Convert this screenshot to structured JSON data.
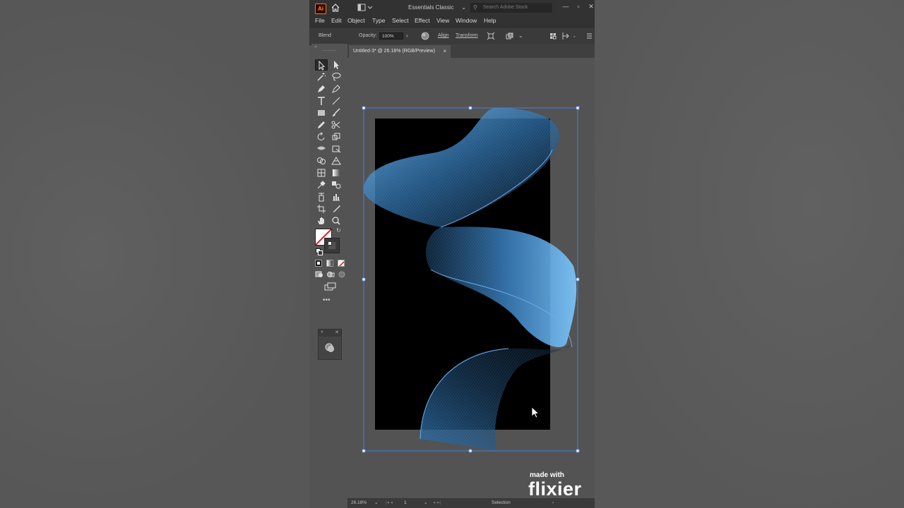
{
  "app": {
    "logo": "Ai",
    "workspace": "Essentials Classic",
    "search_placeholder": "Search Adobe Stock",
    "menus": [
      "File",
      "Edit",
      "Object",
      "Type",
      "Select",
      "Effect",
      "View",
      "Window",
      "Help"
    ]
  },
  "controlbar": {
    "selection_type": "Blend",
    "opacity_label": "Opacity:",
    "opacity_value": "100%",
    "align_label": "Align",
    "transform_label": "Transform"
  },
  "document": {
    "tab_title": "Untitled-3* @ 26.18% (RGB/Preview)",
    "tab_close": "×",
    "zoom": "26.18%",
    "artboard_number": "1",
    "status_tool": "Selection"
  },
  "watermark": {
    "line1": "made with",
    "line2": "flixier"
  },
  "colors": {
    "accent_blue": "#5aa8f0",
    "selection_box": "#4a7fd8",
    "artboard": "#000000",
    "app_bg": "#535353"
  },
  "icons": {
    "toolbar": [
      "selection-tool-icon",
      "direct-selection-tool-icon",
      "magic-wand-tool-icon",
      "lasso-tool-icon",
      "pen-tool-icon",
      "curvature-tool-icon",
      "type-tool-icon",
      "line-tool-icon",
      "rectangle-tool-icon",
      "paintbrush-tool-icon",
      "pencil-tool-icon",
      "scissors-tool-icon",
      "rotate-tool-icon",
      "scale-tool-icon",
      "width-tool-icon",
      "free-transform-tool-icon",
      "shape-builder-tool-icon",
      "perspective-grid-tool-icon",
      "mesh-tool-icon",
      "gradient-tool-icon",
      "eyedropper-tool-icon",
      "blend-tool-icon",
      "symbol-sprayer-tool-icon",
      "column-graph-tool-icon",
      "artboard-tool-icon",
      "slice-tool-icon",
      "hand-tool-icon",
      "zoom-tool-icon"
    ]
  }
}
